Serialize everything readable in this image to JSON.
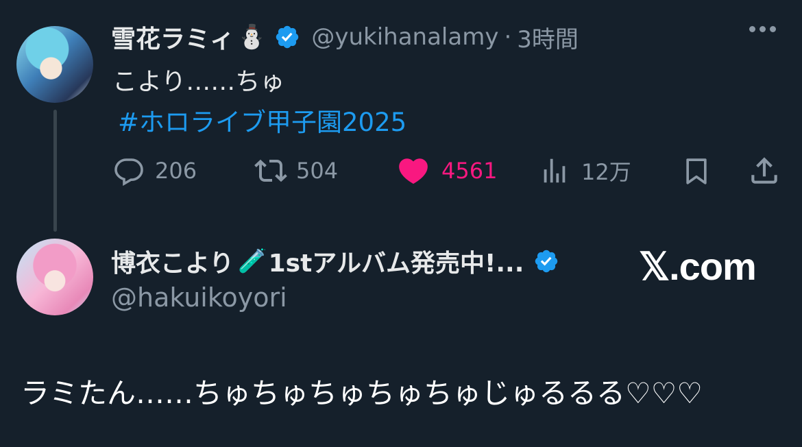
{
  "tweet1": {
    "name": "雪花ラミィ",
    "name_emoji": "⛄",
    "handle": "@yukihanalamy",
    "separator": "·",
    "time": "3時間",
    "text": "こより……ちゅ",
    "hashtag": "#ホロライブ甲子園2025",
    "actions": {
      "reply_count": "206",
      "retweet_count": "504",
      "like_count": "4561",
      "views_count": "12万"
    },
    "icons": [
      "reply-icon",
      "retweet-icon",
      "heart-icon",
      "views-icon",
      "bookmark-icon",
      "share-icon",
      "more-icon",
      "verified-badge-icon"
    ]
  },
  "tweet2": {
    "name": "博衣こより",
    "name_emoji": "🧪",
    "name_suffix": "1stアルバム発売中!...",
    "handle": "@hakuikoyori",
    "text": "ラミたん……ちゅちゅちゅちゅちゅじゅるるる♡♡♡"
  },
  "watermark": "𝕏.com",
  "colors": {
    "background": "#15202b",
    "text": "#e7e9ea",
    "muted": "#8b98a5",
    "link": "#1d9bf0",
    "like": "#f91880",
    "verified": "#1d9bf0"
  }
}
